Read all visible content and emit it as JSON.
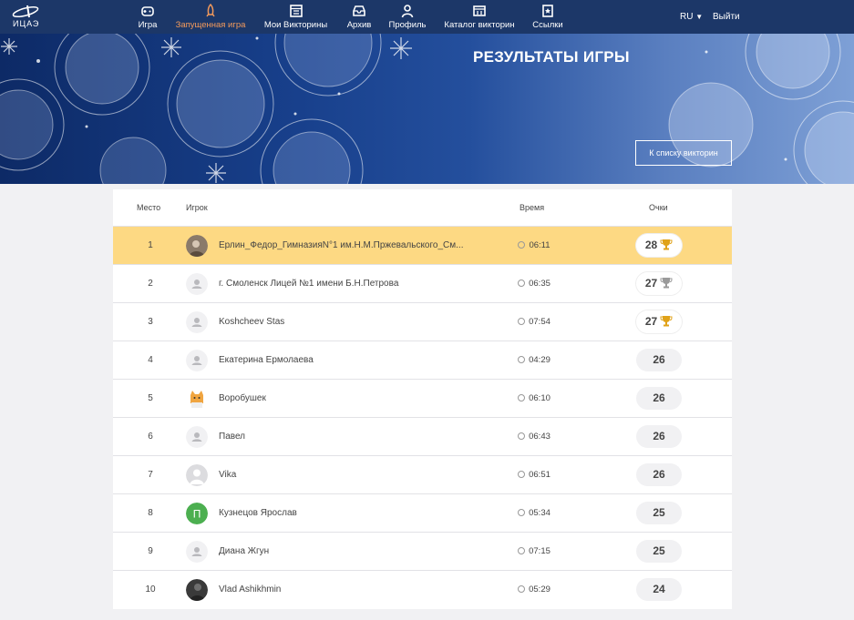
{
  "logo": {
    "text": "ИЦАЭ"
  },
  "nav": [
    {
      "label": "Игра",
      "icon": "gamepad-icon",
      "active": false
    },
    {
      "label": "Запущенная игра",
      "icon": "rocket-icon",
      "active": true
    },
    {
      "label": "Мои Викторины",
      "icon": "window-icon",
      "active": false
    },
    {
      "label": "Архив",
      "icon": "archive-icon",
      "active": false
    },
    {
      "label": "Профиль",
      "icon": "user-icon",
      "active": false
    },
    {
      "label": "Каталог викторин",
      "icon": "catalog-icon",
      "active": false
    },
    {
      "label": "Ссылки",
      "icon": "bookmark-icon",
      "active": false
    }
  ],
  "lang": "RU",
  "logout": "Выйти",
  "banner": {
    "title": "РЕЗУЛЬТАТЫ ИГРЫ",
    "button": "К списку викторин"
  },
  "table": {
    "headers": {
      "place": "Место",
      "player": "Игрок",
      "time": "Время",
      "score": "Очки"
    },
    "rows": [
      {
        "rank": "1",
        "name": "Ерлин_Федор_ГимназияN°1 им.Н.М.Пржевальского_См...",
        "time": "06:11",
        "score": "28",
        "trophy": "gold",
        "avatar": "photo"
      },
      {
        "rank": "2",
        "name": "г. Смоленск Лицей №1 имени Б.Н.Петрова",
        "time": "06:35",
        "score": "27",
        "trophy": "silver",
        "avatar": "default"
      },
      {
        "rank": "3",
        "name": "Koshcheev Stas",
        "time": "07:54",
        "score": "27",
        "trophy": "gold",
        "avatar": "default"
      },
      {
        "rank": "4",
        "name": "Екатерина Ермолаева",
        "time": "04:29",
        "score": "26",
        "trophy": "none",
        "avatar": "default"
      },
      {
        "rank": "5",
        "name": "Воробушек",
        "time": "06:10",
        "score": "26",
        "trophy": "none",
        "avatar": "cat"
      },
      {
        "rank": "6",
        "name": "Павел",
        "time": "06:43",
        "score": "26",
        "trophy": "none",
        "avatar": "default"
      },
      {
        "rank": "7",
        "name": "Vika",
        "time": "06:51",
        "score": "26",
        "trophy": "none",
        "avatar": "gray"
      },
      {
        "rank": "8",
        "name": "Кузнецов Ярослав",
        "time": "05:34",
        "score": "25",
        "trophy": "none",
        "avatar": "letter",
        "letter": "П"
      },
      {
        "rank": "9",
        "name": "Диана Жгун",
        "time": "07:15",
        "score": "25",
        "trophy": "none",
        "avatar": "default"
      },
      {
        "rank": "10",
        "name": "Vlad Ashikhmin",
        "time": "05:29",
        "score": "24",
        "trophy": "none",
        "avatar": "dark-photo"
      }
    ]
  },
  "colors": {
    "navbar": "#1c3768",
    "active_nav": "#f39a5b",
    "first_row": "#fdd983",
    "gold": "#e0a218",
    "silver": "#9a9a9a",
    "letter_avatar": "#4caf50"
  }
}
